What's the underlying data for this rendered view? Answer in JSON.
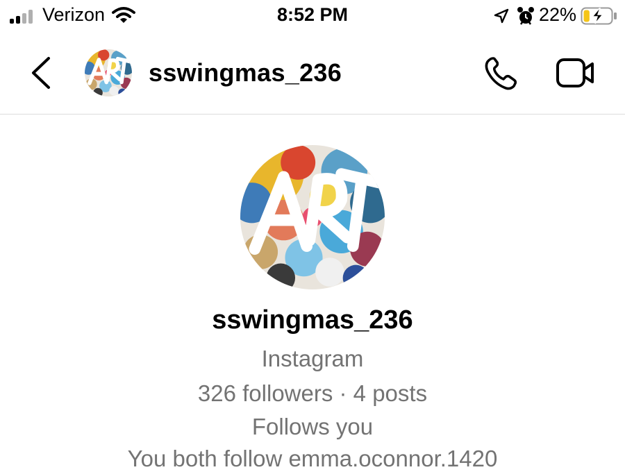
{
  "status_bar": {
    "carrier": "Verizon",
    "time": "8:52 PM",
    "battery_percent": "22%",
    "battery_level": 0.22,
    "signal_bars": 2,
    "icons": [
      "signal-icon",
      "wifi-icon",
      "location-arrow-icon",
      "alarm-icon",
      "battery-charging-icon"
    ]
  },
  "header": {
    "username": "sswingmas_236",
    "icons": [
      "back-chevron-icon",
      "phone-icon",
      "video-camera-icon"
    ]
  },
  "profile": {
    "username": "sswingmas_236",
    "platform": "Instagram",
    "stats": "326 followers · 4 posts",
    "follows_you": "Follows you",
    "mutual": "You both follow emma.oconnor.1420"
  },
  "colors": {
    "secondary_text": "#737373",
    "divider": "#dcdcdc",
    "battery_fill": "#f5c518"
  }
}
